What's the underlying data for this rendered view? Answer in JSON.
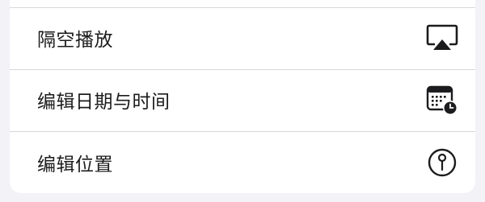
{
  "menu": {
    "items": [
      {
        "label": "隔空播放",
        "icon": "airplay-icon"
      },
      {
        "label": "编辑日期与时间",
        "icon": "calendar-clock-icon"
      },
      {
        "label": "编辑位置",
        "icon": "location-pin-icon"
      }
    ]
  },
  "colors": {
    "background": "#f2f2f7",
    "card": "#ffffff",
    "text": "#1c1c1e",
    "divider": "#d8d8dc"
  }
}
